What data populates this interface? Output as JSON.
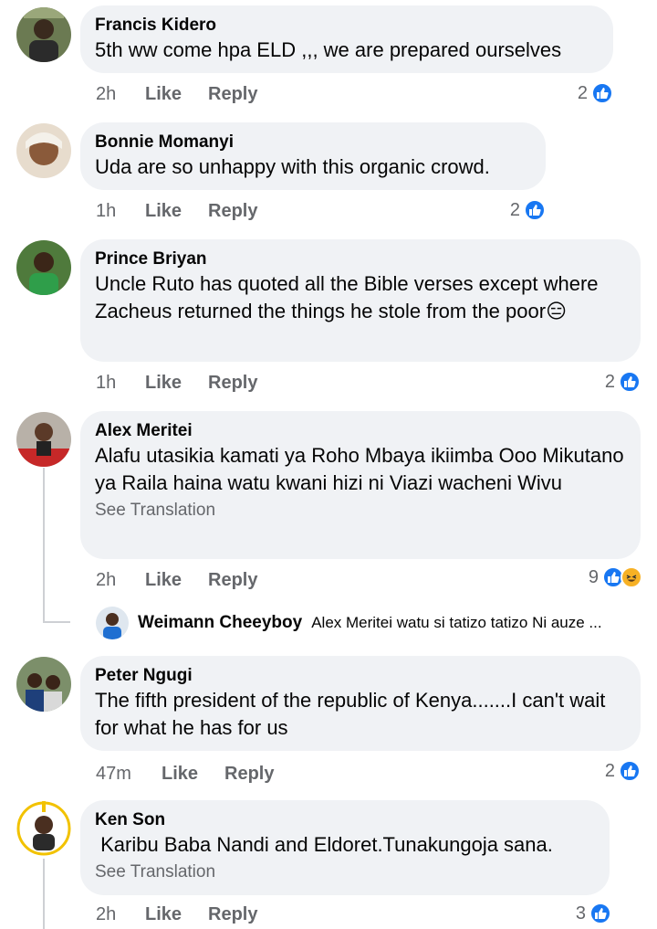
{
  "colors": {
    "like_blue": "#1877f2",
    "bubble_bg": "#f0f2f5",
    "meta_gray": "#65676b"
  },
  "comments": [
    {
      "author": "Francis Kidero",
      "text": "5th ww come hpa ELD ,,, we are prepared ourselves",
      "time": "2h",
      "like": "Like",
      "reply": "Reply",
      "reaction_count": "2"
    },
    {
      "author": "Bonnie Momanyi",
      "text": "Uda are so unhappy with this organic crowd.",
      "time": "1h",
      "like": "Like",
      "reply": "Reply",
      "reaction_count": "2"
    },
    {
      "author": "Prince Briyan",
      "text": "Uncle Ruto has quoted all the Bible verses except where Zacheus returned the things he stole from the poor😑",
      "time": "1h",
      "like": "Like",
      "reply": "Reply",
      "reaction_count": "2"
    },
    {
      "author": "Alex Meritei",
      "text": "Alafu utasikia kamati ya Roho Mbaya ikiimba Ooo Mikutano ya Raila haina watu kwani hizi ni Viazi wacheni Wivu",
      "see_translation": "See Translation",
      "time": "2h",
      "like": "Like",
      "reply": "Reply",
      "reaction_count": "9",
      "reply_preview": {
        "author": "Weimann Cheeyboy",
        "text": "Alex Meritei watu si tatizo tatizo Ni auze ..."
      }
    },
    {
      "author": "Peter Ngugi",
      "text": "The fifth president of the republic of Kenya.......I can't wait for what he has for us",
      "time": "47m",
      "like": "Like",
      "reply": "Reply",
      "reaction_count": "2"
    },
    {
      "author": "Ken Son",
      "text": " Karibu Baba Nandi and Eldoret.Tunakungoja sana.",
      "see_translation": "See Translation",
      "time": "2h",
      "like": "Like",
      "reply": "Reply",
      "reaction_count": "3"
    }
  ]
}
